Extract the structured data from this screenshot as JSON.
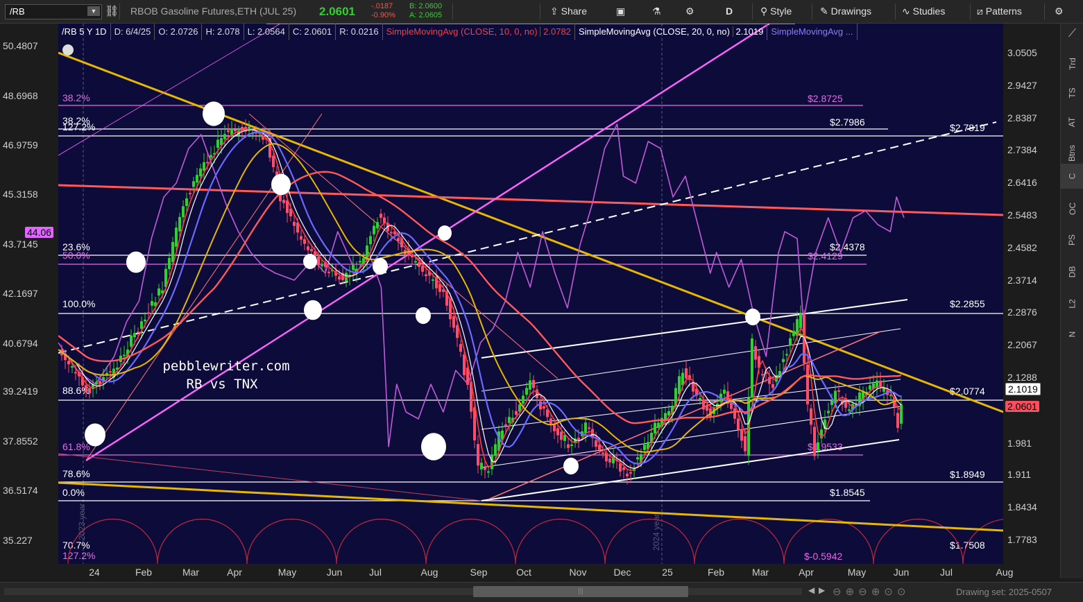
{
  "toolbar": {
    "symbol": "/RB",
    "description": "RBOB Gasoline Futures,ETH (JUL 25)",
    "last_price": "2.0601",
    "change": "-.0187",
    "change_pct": "-0.90%",
    "bid": "B: 2.0600",
    "ask": "A: 2.0605",
    "share": "Share",
    "aggregation": "D",
    "style": "Style",
    "drawings": "Drawings",
    "studies": "Studies",
    "patterns": "Patterns"
  },
  "legend": {
    "symbol_period": "/RB 5 Y 1D",
    "date": "D: 6/4/25",
    "open": "O: 2.0726",
    "high": "H: 2.078",
    "low": "L: 2.0564",
    "close": "C: 2.0601",
    "range": "R: 0.0216",
    "sma10_label": "SimpleMovingAvg (CLOSE, 10, 0, no)",
    "sma10_value": "2.0782",
    "sma20_label": "SimpleMovingAvg (CLOSE, 20, 0, no)",
    "sma20_value": "2.1019",
    "sma_more": "SimpleMovingAvg ..."
  },
  "left_axis": [
    "50.4807",
    "48.6968",
    "46.9759",
    "45.3158",
    "43.7145",
    "42.1697",
    "40.6794",
    "39.2419",
    "37.8552",
    "36.5174",
    "35.227"
  ],
  "left_tag": "44.06",
  "right_axis": [
    "3.0505",
    "2.9427",
    "2.8387",
    "2.7384",
    "2.6416",
    "2.5483",
    "2.4582",
    "2.3714",
    "2.2876",
    "2.2067",
    "2.1288",
    "1.981",
    "1.911",
    "1.8434",
    "1.7783"
  ],
  "right_tags": {
    "sma20": "2.1019",
    "last": "2.0601"
  },
  "x_axis": [
    "24",
    "Feb",
    "Mar",
    "Apr",
    "May",
    "Jun",
    "Jul",
    "Aug",
    "Sep",
    "Oct",
    "Nov",
    "Dec",
    "25",
    "Feb",
    "Mar",
    "Apr",
    "May",
    "Jun",
    "Jul",
    "Aug"
  ],
  "year_markers": [
    "2023 year",
    "2024 year"
  ],
  "fib_left": [
    {
      "label": "38.2%",
      "color": "#e66be6"
    },
    {
      "label": "38.2%",
      "color": "#ffffff"
    },
    {
      "label": "127.2%",
      "color": "#ffffff"
    },
    {
      "label": "23.6%",
      "color": "#ffffff"
    },
    {
      "label": "50.0%",
      "color": "#e66be6"
    },
    {
      "label": "100.0%",
      "color": "#ffffff"
    },
    {
      "label": "88.6%",
      "color": "#ffffff"
    },
    {
      "label": "61.8%",
      "color": "#e66be6"
    },
    {
      "label": "78.6%",
      "color": "#ffffff"
    },
    {
      "label": "0.0%",
      "color": "#ffffff"
    },
    {
      "label": "70.7%",
      "color": "#ffffff"
    },
    {
      "label": "127.2%",
      "color": "#e66be6"
    }
  ],
  "price_labels": [
    {
      "label": "$2.8725",
      "color": "#e66be6"
    },
    {
      "label": "$2.7986",
      "color": "#ffffff"
    },
    {
      "label": "$2.7819",
      "color": "#ffffff"
    },
    {
      "label": "$2.4378",
      "color": "#ffffff"
    },
    {
      "label": "$2.4129",
      "color": "#e66be6"
    },
    {
      "label": "$2.2855",
      "color": "#ffffff"
    },
    {
      "label": "$2.0774",
      "color": "#ffffff"
    },
    {
      "label": "$1.9533",
      "color": "#e66be6"
    },
    {
      "label": "$1.8949",
      "color": "#ffffff"
    },
    {
      "label": "$1.8545",
      "color": "#ffffff"
    },
    {
      "label": "$1.7508",
      "color": "#ffffff"
    },
    {
      "label": "$-0.5942",
      "color": "#e66be6"
    }
  ],
  "watermark": {
    "line1": "pebblewriter.com",
    "line2": "RB vs TNX"
  },
  "side_tabs": [
    "Trd",
    "TS",
    "AT",
    "Btns",
    "C",
    "OC",
    "PS",
    "DB",
    "L2",
    "N"
  ],
  "drawing_set": "Drawing set: 2025-0507",
  "colors": {
    "background": "#0d0b3a",
    "sma10": "#ff3b3b",
    "sma20": "#ffffff",
    "sma50": "#6a6aff",
    "sma100": "#e6b800",
    "sma200": "#ff5a5a",
    "tnx": "#c05bd8",
    "up_candle": "#2fd12f",
    "down_candle": "#ff4d6a"
  }
}
